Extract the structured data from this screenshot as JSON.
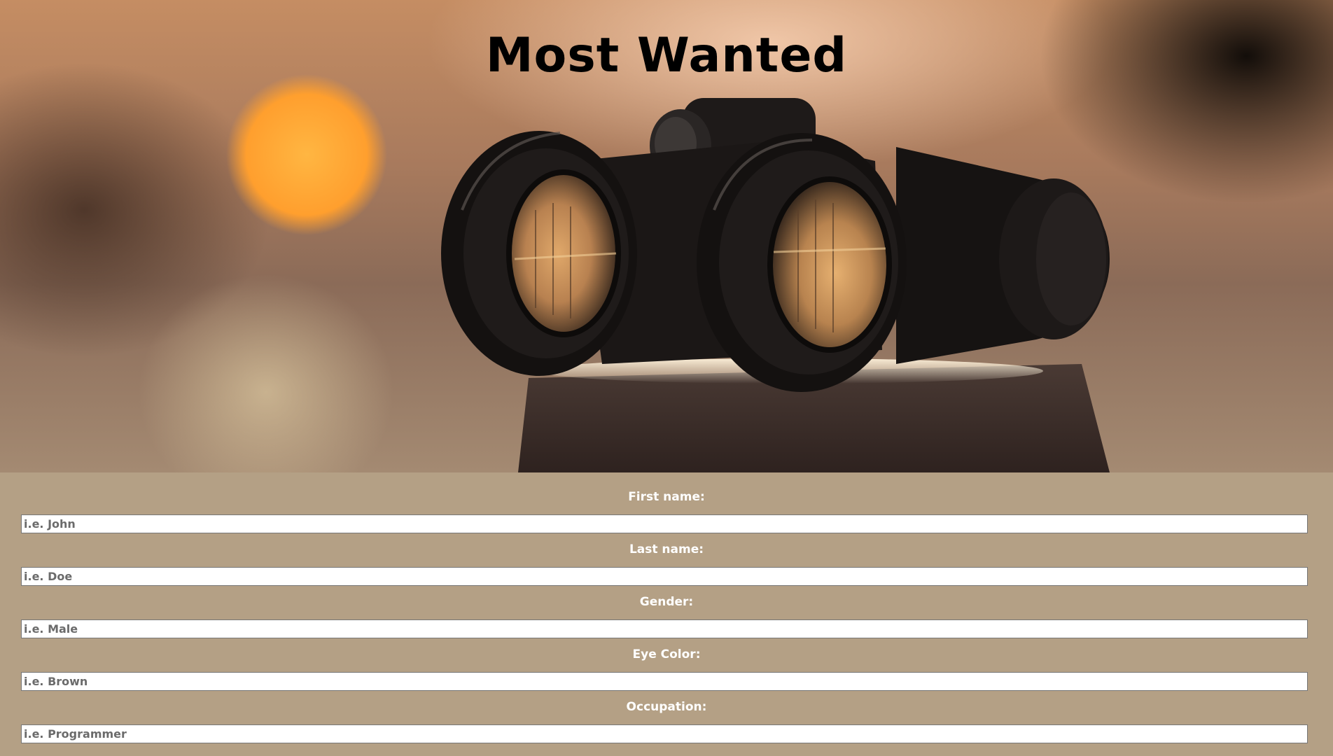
{
  "page": {
    "title": "Most Wanted"
  },
  "form": {
    "fields": [
      {
        "label": "First name:",
        "placeholder": "i.e. John"
      },
      {
        "label": "Last name:",
        "placeholder": "i.e. Doe"
      },
      {
        "label": "Gender:",
        "placeholder": "i.e. Male"
      },
      {
        "label": "Eye Color:",
        "placeholder": "i.e. Brown"
      },
      {
        "label": "Occupation:",
        "placeholder": "i.e. Programmer"
      }
    ]
  },
  "colors": {
    "form_background": "#b4a085",
    "label_text": "#ffffff",
    "title_text": "#000000"
  }
}
